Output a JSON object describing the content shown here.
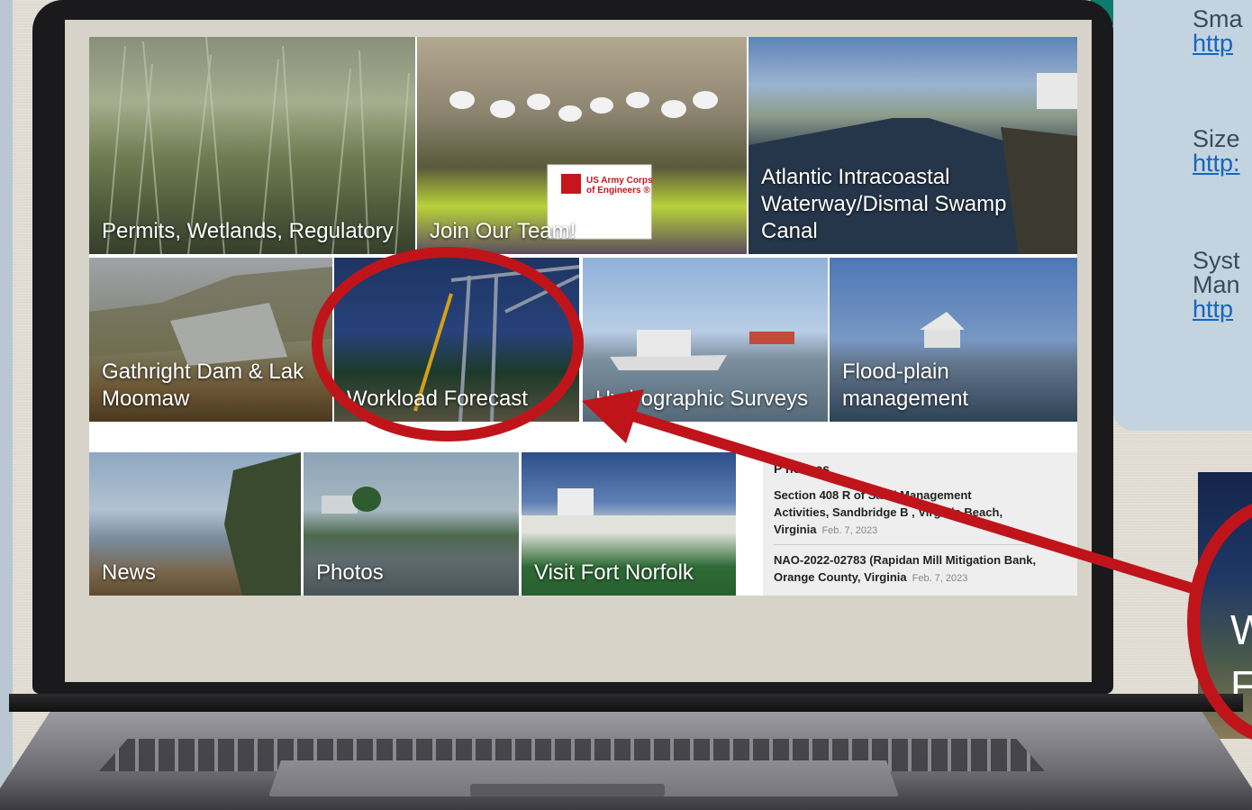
{
  "right_notes": [
    {
      "label": "Sma",
      "link": "http"
    },
    {
      "label": "Size",
      "link": "http:"
    },
    {
      "label_line1": "Syst",
      "label_line2": "Man",
      "link": "http"
    }
  ],
  "thumbnail": {
    "line1": "W",
    "line2": "F"
  },
  "tiles": {
    "permits": "Permits, Wetlands, Regulatory",
    "join": "Join Our Team!",
    "atlantic_line1": "Atlantic Intracoastal",
    "atlantic_line2": "Waterway/Dismal Swamp",
    "atlantic_line3": "Canal",
    "gathright_line1": "Gathright Dam & Lak",
    "gathright_line2": "Moomaw",
    "workload": "Workload Forecast",
    "hydro": "Hydrographic Surveys",
    "flood_line1": "Flood-plain",
    "flood_line2": "management",
    "news": "News",
    "photos": "Photos",
    "fort": "Visit Fort Norfolk"
  },
  "sign": {
    "line1": "US Army Corps",
    "line2": "of Engineers ®"
  },
  "notices": {
    "heading": "P    notices",
    "items": [
      {
        "line1": "Section 408 R          of Sand Management",
        "line2": "Activities, Sandbridge B      , Virginia Beach,",
        "line3": "Virginia",
        "date": "Feb. 7, 2023"
      },
      {
        "line1": "NAO-2022-02783 (Rapidan Mill Mitigation Bank,",
        "line2": "Orange County, Virginia",
        "date": "Feb. 7, 2023"
      }
    ]
  },
  "colors": {
    "annotation_red": "#c0141b",
    "link_blue": "#1565c0"
  }
}
